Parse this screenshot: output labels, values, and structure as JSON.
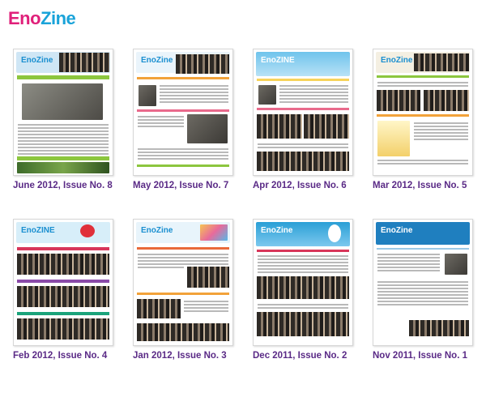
{
  "logo": {
    "part1": "Eno",
    "part2": "Zine"
  },
  "issues": [
    {
      "label": "June 2012, Issue No. 8"
    },
    {
      "label": "May 2012, Issue No. 7"
    },
    {
      "label": "Apr 2012, Issue No. 6"
    },
    {
      "label": "Mar 2012, Issue No. 5"
    },
    {
      "label": "Feb 2012, Issue No. 4"
    },
    {
      "label": "Jan 2012, Issue No. 3"
    },
    {
      "label": "Dec 2011, Issue No. 2"
    },
    {
      "label": "Nov 2011, Issue No. 1"
    }
  ],
  "colors": {
    "caption": "#5a2a86",
    "logo_pink": "#e0207a",
    "logo_blue": "#1aa3d9"
  }
}
